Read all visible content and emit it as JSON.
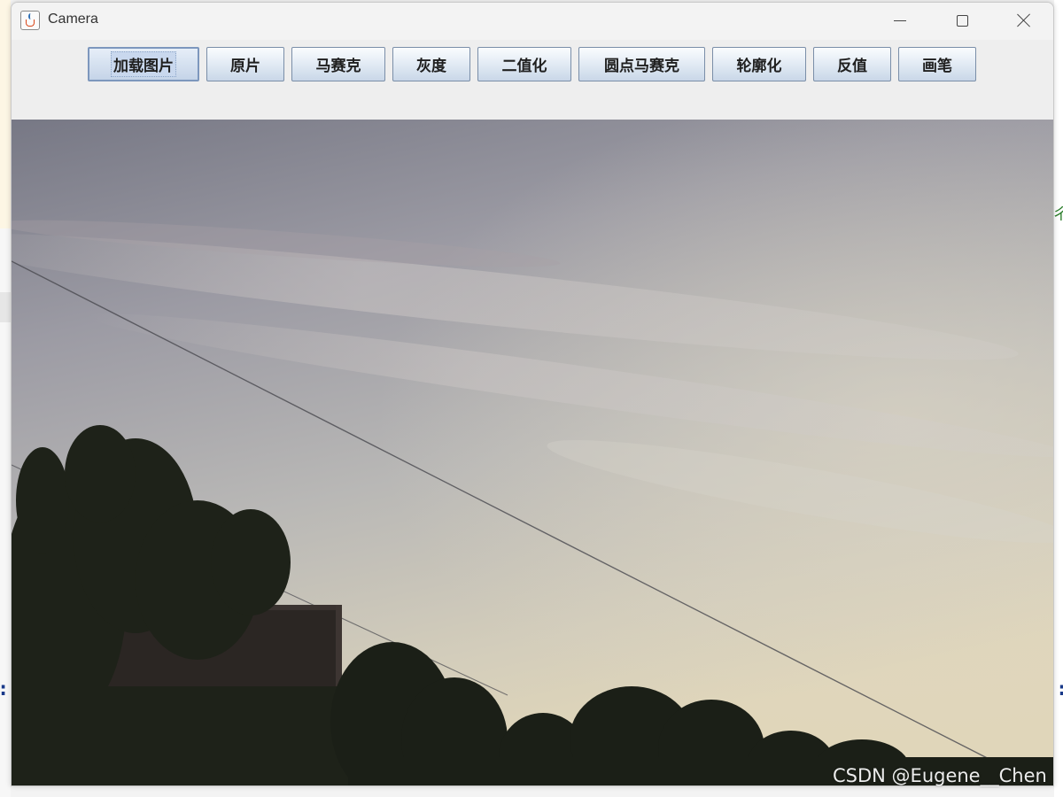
{
  "window": {
    "title": "Camera"
  },
  "toolbar": {
    "buttons": [
      {
        "id": "load-image",
        "label": "加载图片",
        "focused": true
      },
      {
        "id": "original",
        "label": "原片"
      },
      {
        "id": "mosaic",
        "label": "马赛克"
      },
      {
        "id": "grayscale",
        "label": "灰度"
      },
      {
        "id": "binarize",
        "label": "二值化"
      },
      {
        "id": "dot-mosaic",
        "label": "圆点马赛克"
      },
      {
        "id": "outline",
        "label": "轮廓化"
      },
      {
        "id": "invert",
        "label": "反值"
      },
      {
        "id": "brush",
        "label": "画笔"
      }
    ]
  },
  "background": {
    "right_glyph": "ㄔ",
    "left_colon": ":",
    "right_colon": ":"
  },
  "watermark": "CSDN @Eugene__Chen",
  "colors": {
    "button_border": "#7a8ea8",
    "sky_top": "#7a7b88",
    "sky_bottom": "#d8d2be",
    "foliage": "#1f231c"
  },
  "icons": {
    "app": "java-coffee-cup-icon",
    "minimize": "minimize-icon",
    "maximize": "maximize-icon",
    "close": "close-icon"
  }
}
